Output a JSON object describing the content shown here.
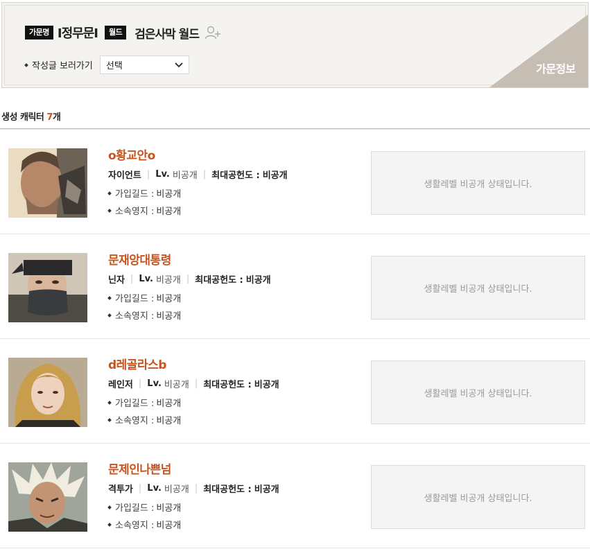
{
  "header": {
    "family_tag": "가문명",
    "family_name": "I정무문I",
    "world_tag": "월드",
    "world_name": "검은사막 월드",
    "corner_label": "가문정보",
    "view_label": "작성글 보러가기",
    "select_value": "선택"
  },
  "section": {
    "title_prefix": "생성 캐릭터 ",
    "count": "7",
    "title_suffix": "개"
  },
  "labels": {
    "lv": "Lv.",
    "max_contribution": "최대공헌도 :",
    "guild": "가입길드 :",
    "territory": "소속영지 :"
  },
  "characters": [
    {
      "name": "o황교안o",
      "class": "자이언트",
      "level": "비공개",
      "contribution": "비공개",
      "guild": "비공개",
      "territory": "비공개",
      "life_status": "생활레벨 비공개 상태입니다."
    },
    {
      "name": "문재앙대통령",
      "class": "닌자",
      "level": "비공개",
      "contribution": "비공개",
      "guild": "비공개",
      "territory": "비공개",
      "life_status": "생활레벨 비공개 상태입니다."
    },
    {
      "name": "d레골라스b",
      "class": "레인저",
      "level": "비공개",
      "contribution": "비공개",
      "guild": "비공개",
      "territory": "비공개",
      "life_status": "생활레벨 비공개 상태입니다."
    },
    {
      "name": "문제인나쁜넘",
      "class": "격투가",
      "level": "비공개",
      "contribution": "비공개",
      "guild": "비공개",
      "territory": "비공개",
      "life_status": "생활레벨 비공개 상태입니다."
    }
  ],
  "colors": {
    "accent": "#c8541d",
    "header_bg": "#f5f3ef",
    "corner_bg": "#c6bdb3",
    "life_box_bg": "#f4f4f4"
  }
}
